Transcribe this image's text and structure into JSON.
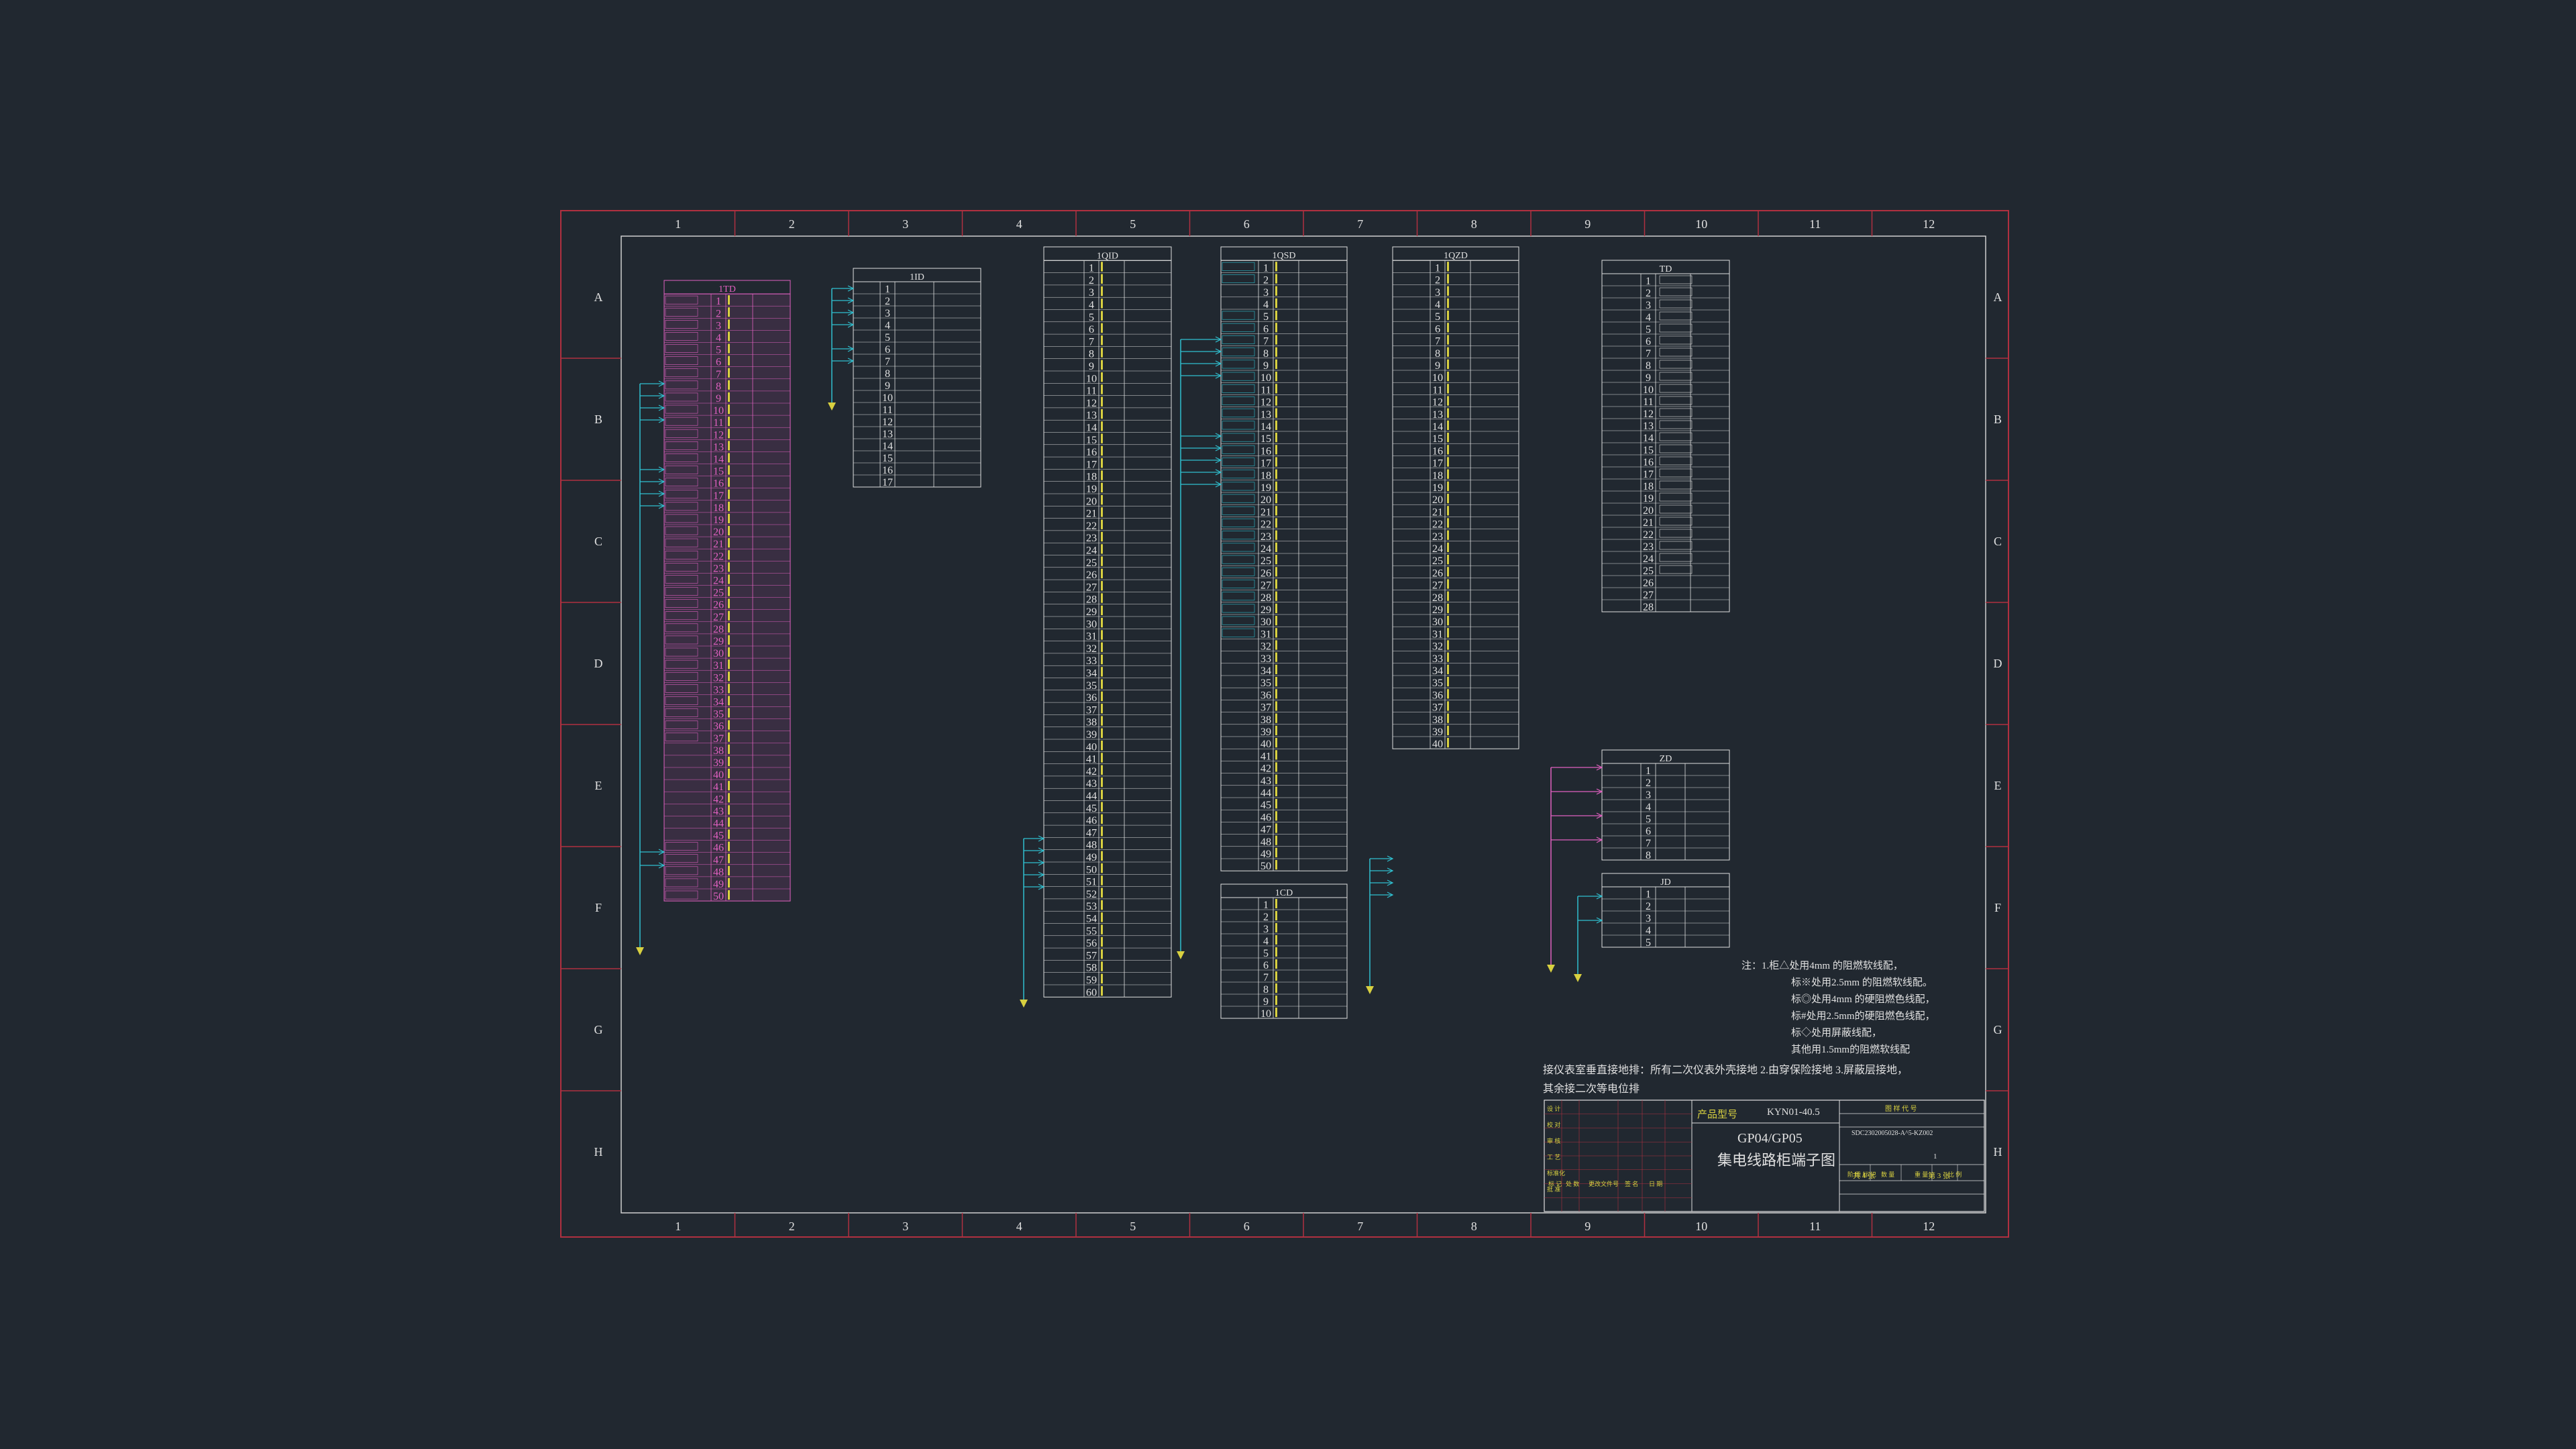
{
  "frame": {
    "columns": [
      "1",
      "2",
      "3",
      "4",
      "5",
      "6",
      "7",
      "8",
      "9",
      "10",
      "11",
      "12"
    ],
    "rows": [
      "A",
      "B",
      "C",
      "D",
      "E",
      "F",
      "G",
      "H"
    ],
    "colors": {
      "border": "#b03040",
      "inner": "#d0d0d0",
      "white": "#e0e0e0",
      "magenta": "#e060c0",
      "cyan": "#30c0d0",
      "yellow": "#d8d040",
      "orange": "#e09030"
    }
  },
  "strips": [
    {
      "id": "1TD",
      "title": "1TD",
      "count": 50
    },
    {
      "id": "1ID",
      "title": "1ID",
      "count": 17
    },
    {
      "id": "1QID",
      "title": "1QID",
      "count": 60
    },
    {
      "id": "1QSD",
      "title": "1QSD",
      "count": 50
    },
    {
      "id": "1QZD",
      "title": "1QZD",
      "count": 40
    },
    {
      "id": "1CD",
      "title": "1CD",
      "count": 10
    },
    {
      "id": "TD",
      "title": "TD",
      "count": 28
    },
    {
      "id": "ZD",
      "title": "ZD",
      "count": 8
    },
    {
      "id": "JD",
      "title": "JD",
      "count": 5
    }
  ],
  "notes": {
    "label": "注：",
    "lines": [
      "1.柜△处用4mm 的阻燃软线配，",
      "标※处用2.5mm 的阻燃软线配。",
      "标◎处用4mm 的硬阻燃色线配，",
      "标#处用2.5mm的硬阻燃色线配，",
      "标◇处用屏蔽线配，",
      "其他用1.5mm的阻燃软线配"
    ],
    "ground_line1": "接仪表室垂直接地排：所有二次仪表外壳接地 2.由穿保险接地 3.屏蔽层接地，",
    "ground_line2": "其余接二次等电位排"
  },
  "title_block": {
    "product_label": "产品型号",
    "product_model": "KYN01-40.5",
    "drawing_title_1": "GP04/GP05",
    "drawing_title_2": "集电线路柜端子图",
    "drawing_number": "SDC2302005028-A^5-KZ002",
    "col_labels": [
      "标 记",
      "处 数",
      "更改文件号",
      "签 名",
      "日 期"
    ],
    "role_labels": [
      "设 计",
      "校 对",
      "审 核",
      "工 艺",
      "标准化",
      "批 准"
    ],
    "stage_labels": [
      "阶 段 标 记",
      "数 量",
      "重 量",
      "比 例"
    ],
    "code_label": "图 样 代 号",
    "sheet_labels": [
      "共 4 张",
      "第 3 张"
    ],
    "scale": "1"
  }
}
